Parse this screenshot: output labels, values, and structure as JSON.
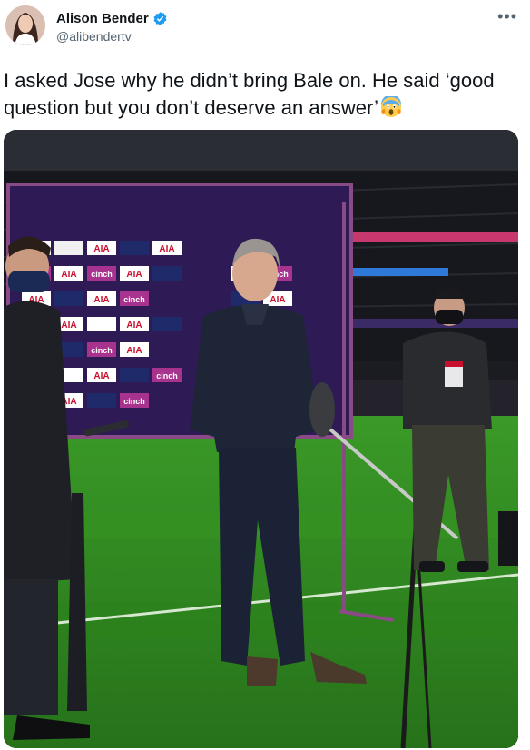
{
  "author": {
    "display_name": "Alison Bender",
    "handle": "@alibendertv",
    "verified": true
  },
  "more_icon": "more-horizontal-icon",
  "tweet": {
    "text": "I asked Jose why he didn’t bring Bale on. He said ‘good question but you don’t deserve an answer’",
    "emoji": "face-screaming-in-fear"
  },
  "photo": {
    "board_words": [
      "AIA",
      "cinch"
    ],
    "colors": {
      "board_bg": "#2e1a55",
      "board_frame": "#8a4a86",
      "pitch": "#2f8a1e",
      "stadium": "#16181d",
      "verified_blue": "#1d9bf0"
    }
  }
}
